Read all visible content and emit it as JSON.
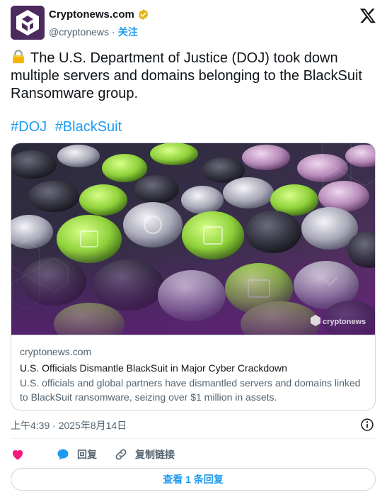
{
  "author": {
    "name": "Cryptonews.com",
    "handle": "@cryptonews",
    "separator": "·",
    "follow_label": "关注",
    "verified_color": "#e2b719"
  },
  "platform_icon": "x-logo-icon",
  "tweet": {
    "emoji_icon": "lock-icon",
    "text": "The U.S. Department of Justice (DOJ) took down multiple servers and domains belonging to the BlackSuit Ransomware group.",
    "hashtags": [
      "#DOJ",
      "#BlackSuit"
    ]
  },
  "card": {
    "watermark": "cryptonews",
    "domain": "cryptonews.com",
    "title": "U.S. Officials Dismantle BlackSuit in Major Cyber Crackdown",
    "description": "U.S. officials and global partners have dismantled servers and domains linked to BlackSuit ransomware, seizing over $1 million in assets."
  },
  "meta": {
    "timestamp": "上午4:39 · 2025年8月14日"
  },
  "actions": {
    "like_icon": "heart-icon",
    "reply_label": "回复",
    "copy_link_label": "复制链接"
  },
  "view_replies_label": "查看 1 条回复",
  "colors": {
    "accent": "#1d9bf0",
    "like": "#f91880",
    "text": "#0f1419",
    "muted": "#536471",
    "border": "#cfd9de"
  }
}
